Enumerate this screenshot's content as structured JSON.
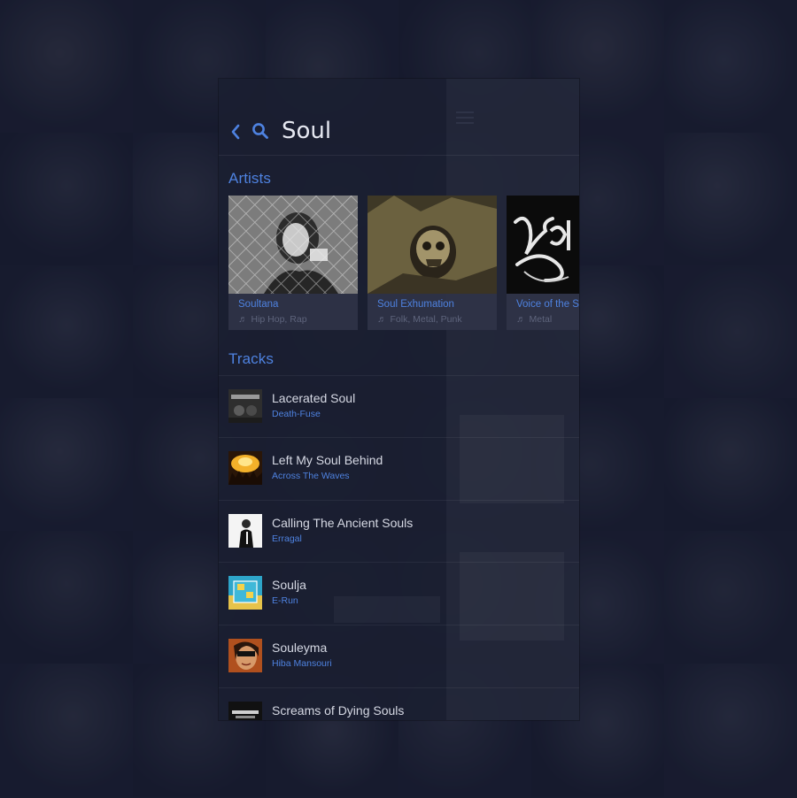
{
  "search": {
    "query": "Soul",
    "back_icon": "chevron-left-icon",
    "search_icon": "search-icon"
  },
  "accent_color": "#4e82e0",
  "artists": {
    "title": "Artists",
    "items": [
      {
        "name": "Soultana",
        "genres": "Hip Hop, Rap"
      },
      {
        "name": "Soul Exhumation",
        "genres": "Folk, Metal, Punk"
      },
      {
        "name": "Voice of the S",
        "genres": "Metal"
      }
    ]
  },
  "tracks": {
    "title": "Tracks",
    "items": [
      {
        "title": "Lacerated Soul",
        "artist": "Death-Fuse"
      },
      {
        "title": "Left My Soul Behind",
        "artist": "Across The Waves"
      },
      {
        "title": "Calling The Ancient Souls",
        "artist": "Erragal"
      },
      {
        "title": "Soulja",
        "artist": "E-Run"
      },
      {
        "title": "Souleyma",
        "artist": "Hiba Mansouri"
      },
      {
        "title": "Screams of Dying Souls",
        "artist": ""
      }
    ]
  }
}
